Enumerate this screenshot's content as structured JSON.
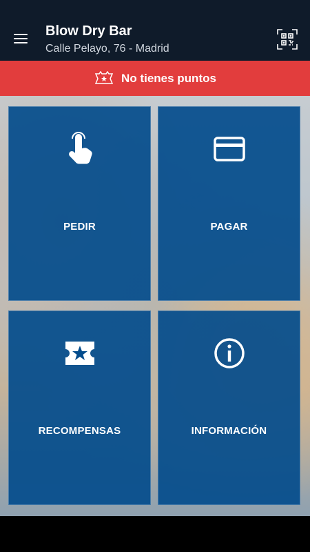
{
  "appbar": {
    "title": "Blow Dry Bar",
    "subtitle": "Calle Pelayo, 76 - Madrid",
    "icons": {
      "menu": "menu-icon",
      "qr": "qr-code-icon"
    }
  },
  "banner": {
    "text": "No tienes puntos",
    "icon": "points-badge-icon",
    "color": "#e23d3d"
  },
  "tiles": [
    {
      "label": "PEDIR",
      "icon": "tap-hand-icon"
    },
    {
      "label": "PAGAR",
      "icon": "credit-card-icon"
    },
    {
      "label": "RECOMPENSAS",
      "icon": "star-ticket-icon"
    },
    {
      "label": "INFORMACIÓN",
      "icon": "info-icon"
    }
  ],
  "colors": {
    "appbar": "#0f1b2a",
    "tile": "#034c8c",
    "banner": "#e23d3d"
  }
}
